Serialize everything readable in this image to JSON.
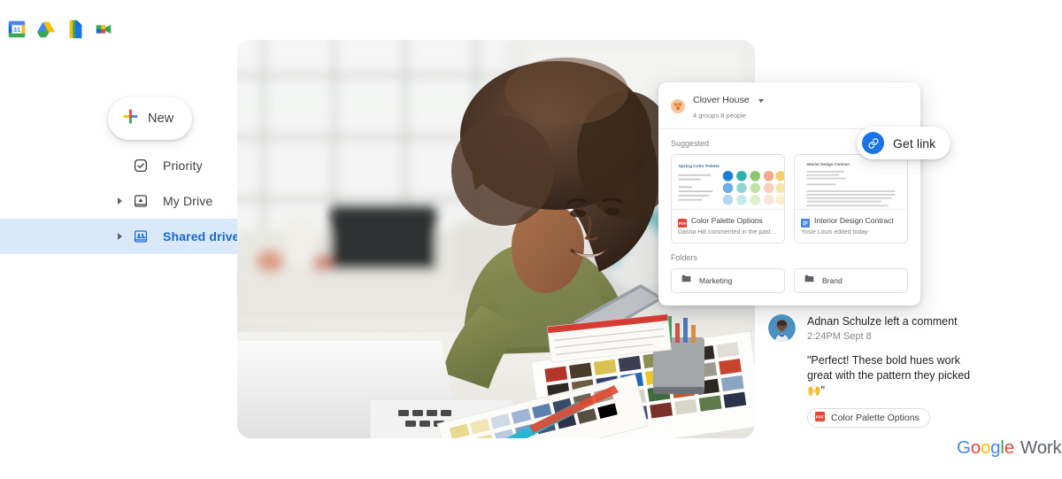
{
  "appbar": {
    "icons": [
      {
        "name": "google-calendar-icon",
        "label": "Google Calendar",
        "day": "31"
      },
      {
        "name": "google-drive-icon",
        "label": "Google Drive"
      },
      {
        "name": "google-docs-icon",
        "label": "Google Docs"
      },
      {
        "name": "google-meet-icon",
        "label": "Google Meet"
      }
    ]
  },
  "sidebar": {
    "new_button": {
      "label": "New",
      "icon": "plus-icon"
    },
    "items": [
      {
        "label": "Priority",
        "icon": "priority-check-icon",
        "expandable": false,
        "active": false
      },
      {
        "label": "My Drive",
        "icon": "my-drive-icon",
        "expandable": true,
        "active": false
      },
      {
        "label": "Shared drives",
        "icon": "shared-drives-icon",
        "expandable": true,
        "active": true
      }
    ]
  },
  "drive_card": {
    "title": "Clover House",
    "subtitle": "4 groups   8 people",
    "suggested_label": "Suggested",
    "folders_label": "Folders",
    "files": [
      {
        "name": "Color Palette Options",
        "meta": "Dasha Hill commented in the past month",
        "type": "pdf",
        "thumb_title": "Spring Color Palette"
      },
      {
        "name": "Interior Design Contract",
        "meta": "Yosie Louis edited today",
        "type": "doc",
        "thumb_title": "Interior Design Contract"
      }
    ],
    "folders": [
      {
        "name": "Marketing",
        "icon": "folder-icon"
      },
      {
        "name": "Brand",
        "icon": "folder-icon"
      }
    ]
  },
  "get_link": {
    "label": "Get link",
    "icon": "link-icon"
  },
  "comment": {
    "heading": "Adnan Schulze left a comment",
    "timestamp": "2:24PM Sept 8",
    "body": "\"Perfect! These bold hues work great with the pattern they picked 🙌\"",
    "chip_label": "Color Palette Options",
    "chip_type": "pdf"
  },
  "brand": {
    "google": [
      "G",
      "o",
      "o",
      "g",
      "l",
      "e"
    ],
    "product": "Workspace"
  },
  "colors": {
    "accent_blue": "#1a73e8",
    "active_nav_bg": "#d9e8fb",
    "active_nav_text": "#1967d2",
    "text_primary": "#202124",
    "text_secondary": "#3c4043",
    "text_muted": "#80868b",
    "pdf_red": "#ea4335",
    "doc_blue": "#4285f4",
    "folder_grey": "#5f6368"
  }
}
